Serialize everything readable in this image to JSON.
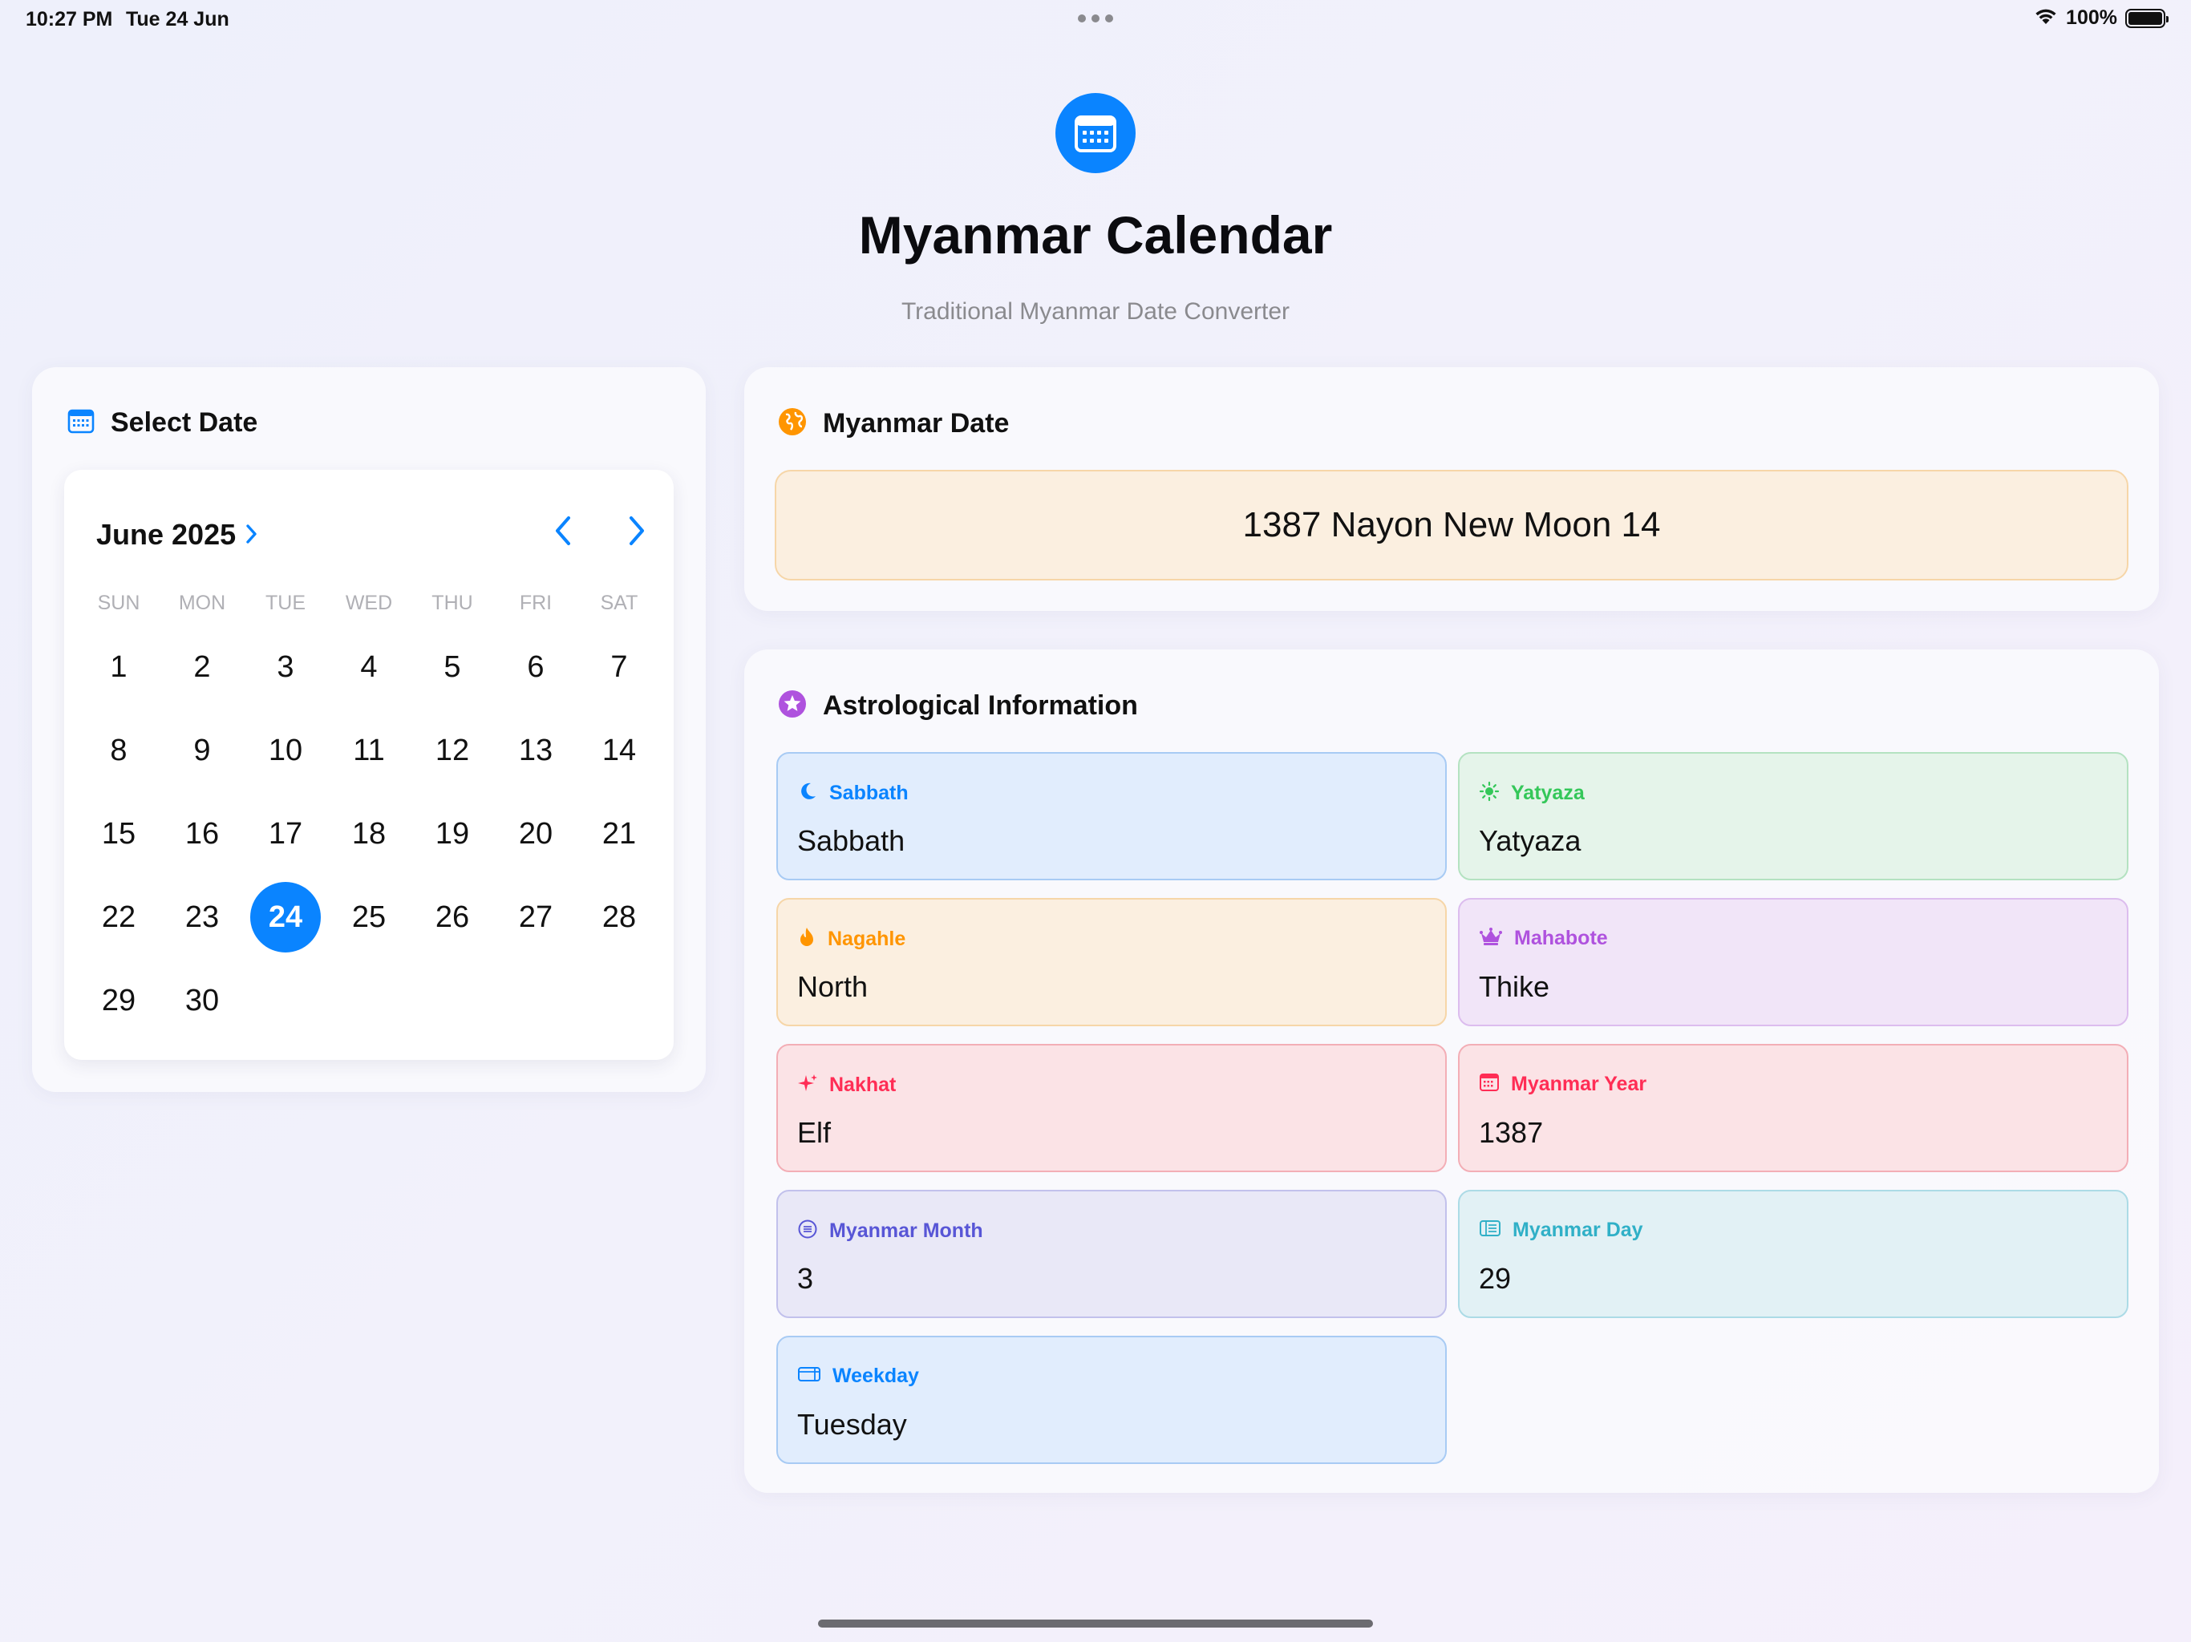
{
  "status_bar": {
    "time": "10:27 PM",
    "date": "Tue 24 Jun",
    "battery": "100%",
    "battery_level": 1.0,
    "icons": [
      "wifi-icon",
      "battery-icon"
    ]
  },
  "header": {
    "icon": "calendar-icon",
    "title": "Myanmar Calendar",
    "subtitle": "Traditional Myanmar Date Converter"
  },
  "select_date": {
    "title": "Select Date",
    "icon": "calendar-icon",
    "calendar": {
      "month_label": "June 2025",
      "weekdays": [
        "SUN",
        "MON",
        "TUE",
        "WED",
        "THU",
        "FRI",
        "SAT"
      ],
      "first_weekday_index": 0,
      "days": [
        "1",
        "2",
        "3",
        "4",
        "5",
        "6",
        "7",
        "8",
        "9",
        "10",
        "11",
        "12",
        "13",
        "14",
        "15",
        "16",
        "17",
        "18",
        "19",
        "20",
        "21",
        "22",
        "23",
        "24",
        "25",
        "26",
        "27",
        "28",
        "29",
        "30"
      ],
      "selected_day": "24"
    }
  },
  "myanmar_date": {
    "title": "Myanmar Date",
    "icon": "globe-icon",
    "value": "1387 Nayon New Moon 14"
  },
  "astro": {
    "title": "Astrological Information",
    "icon": "star-icon",
    "tiles": [
      {
        "label": "Sabbath",
        "value": "Sabbath",
        "icon": "moon-icon",
        "color": "#0a84ff"
      },
      {
        "label": "Yatyaza",
        "value": "Yatyaza",
        "icon": "sun-icon",
        "color": "#34c759"
      },
      {
        "label": "Nagahle",
        "value": "North",
        "icon": "flame-icon",
        "color": "#ff9500"
      },
      {
        "label": "Mahabote",
        "value": "Thike",
        "icon": "crown-icon",
        "color": "#af52de"
      },
      {
        "label": "Nakhat",
        "value": "Elf",
        "icon": "sparkle-icon",
        "color": "#ff2d55"
      },
      {
        "label": "Myanmar Year",
        "value": "1387",
        "icon": "calendar-icon",
        "color": "#ff2d55"
      },
      {
        "label": "Myanmar Month",
        "value": "3",
        "icon": "moon-circle-icon",
        "color": "#5856d6"
      },
      {
        "label": "Myanmar Day",
        "value": "29",
        "icon": "list-icon",
        "color": "#30b0c7"
      },
      {
        "label": "Weekday",
        "value": "Tuesday",
        "icon": "week-icon",
        "color": "#0a84ff"
      }
    ]
  },
  "colors": {
    "accent": "#0a84ff",
    "title": "#0b0b0f",
    "subtitle": "#8a8a8e"
  }
}
